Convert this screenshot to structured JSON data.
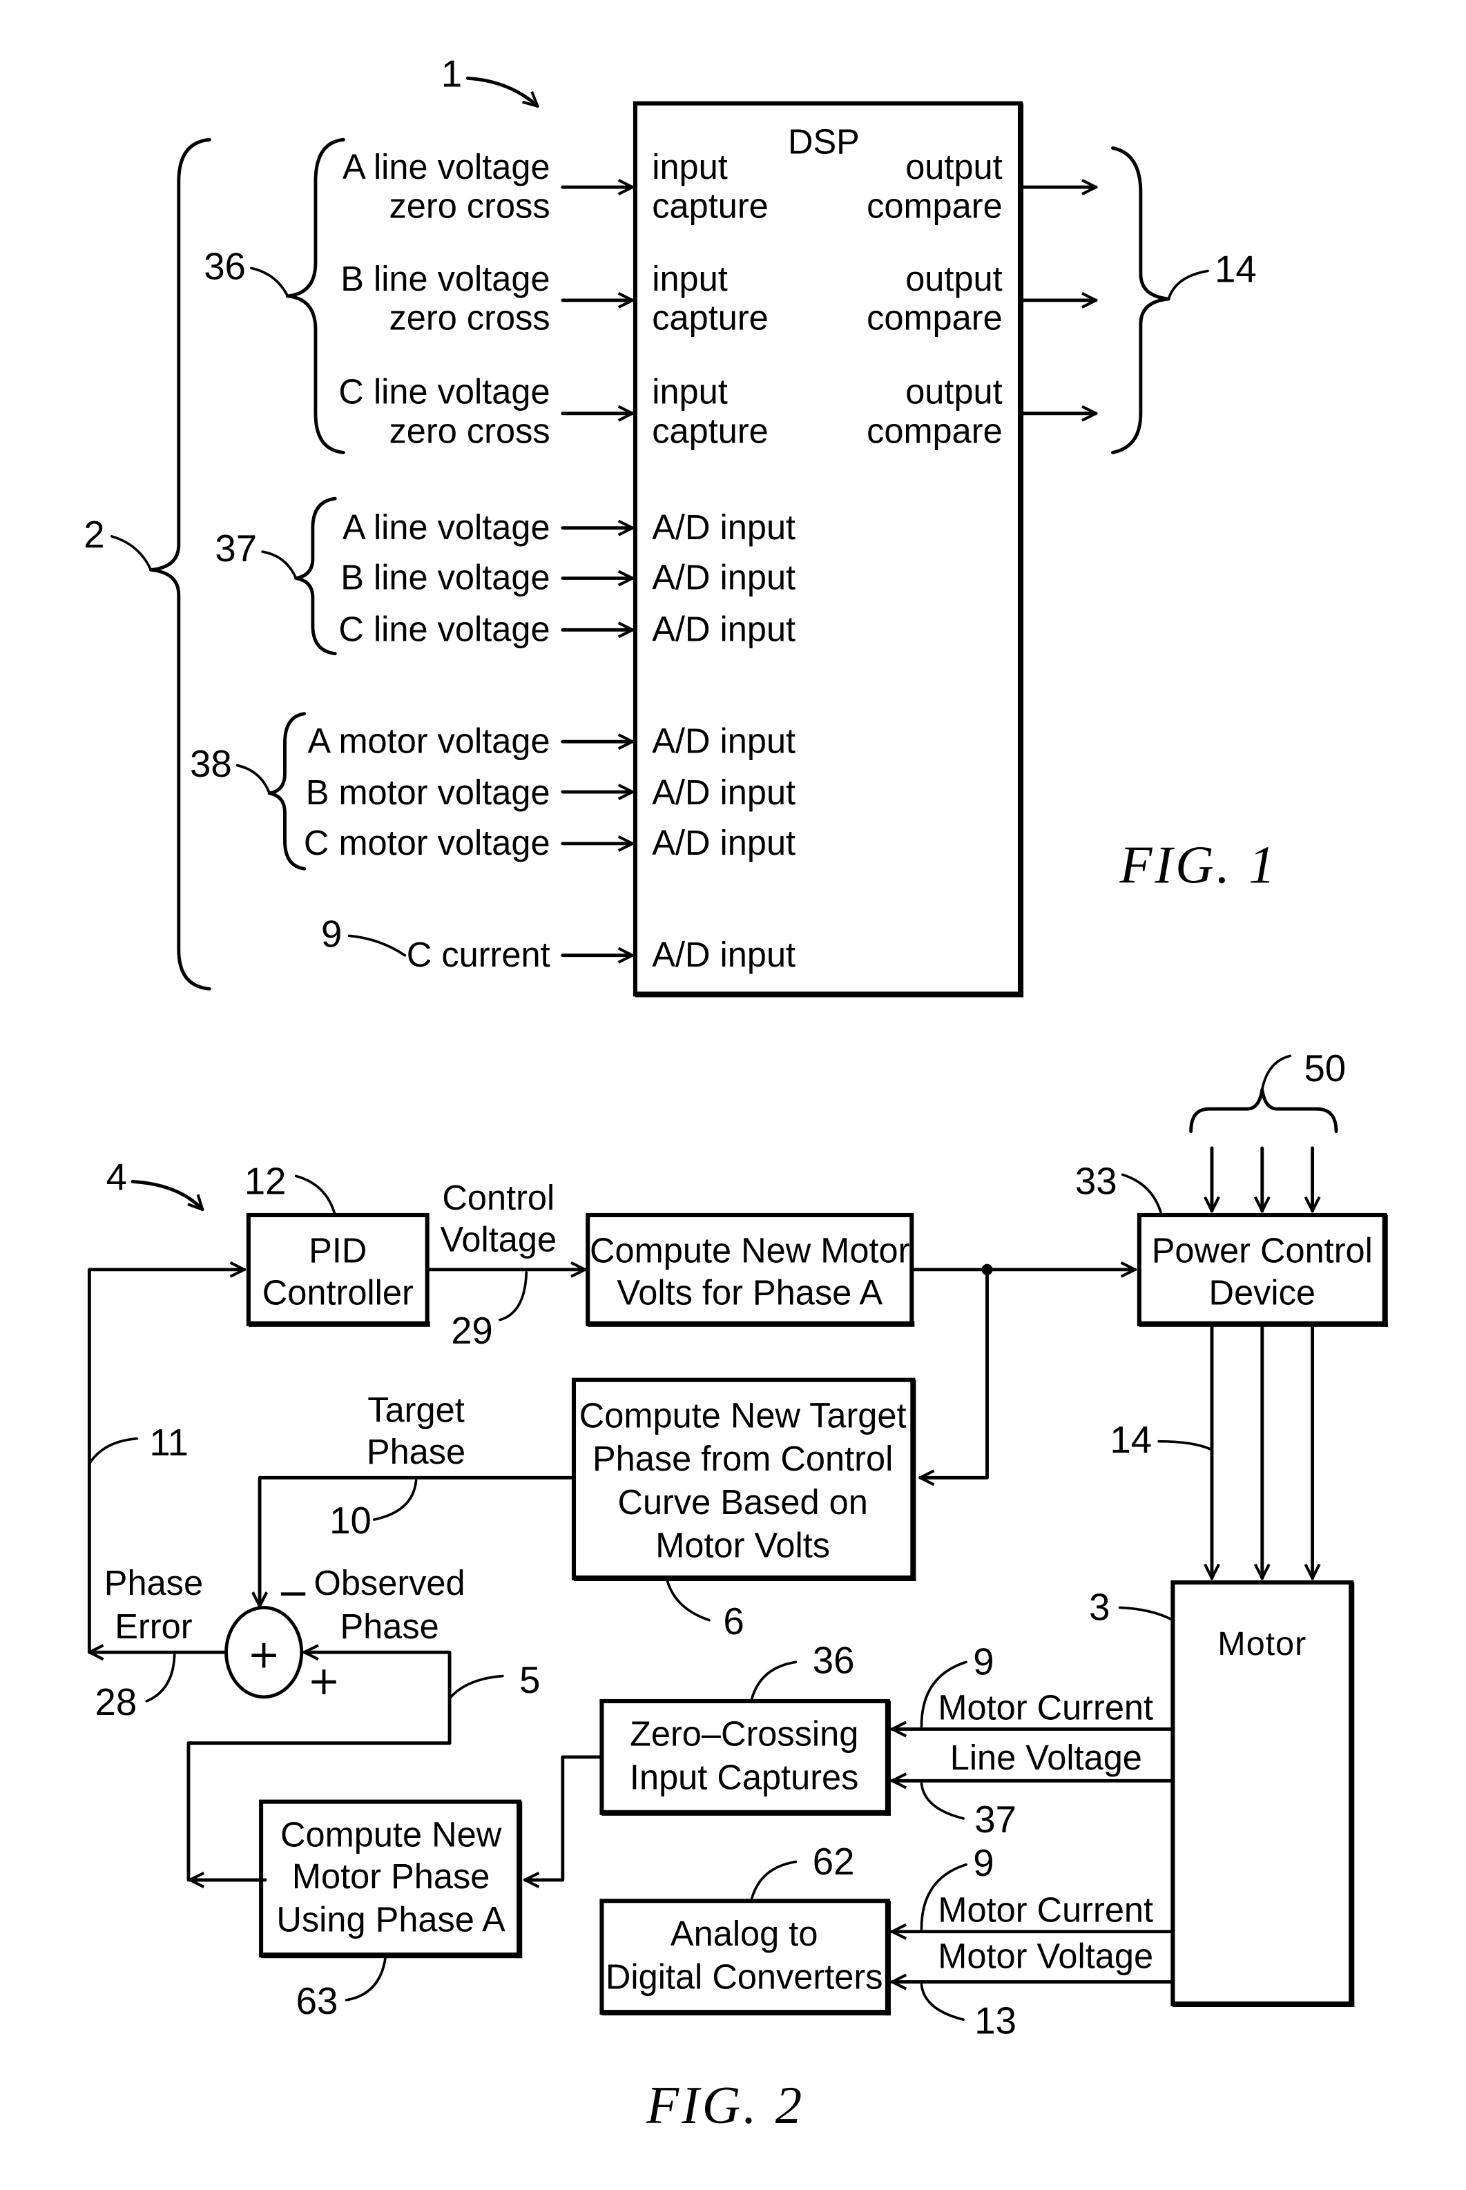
{
  "fig1": {
    "caption": "FIG.  1",
    "dsp_title": "DSP",
    "ref_system": "1",
    "ref_inputs": "2",
    "ref_zero_cross_group": "36",
    "ref_line_voltage_group": "37",
    "ref_motor_voltage_group": "38",
    "ref_current": "9",
    "ref_outputs": "14",
    "zero_cross_inputs": [
      {
        "line1": "A  line  voltage",
        "line2": "zero  cross",
        "port1": "input",
        "port2": "capture",
        "out1": "output",
        "out2": "compare"
      },
      {
        "line1": "B  line  voltage",
        "line2": "zero  cross",
        "port1": "input",
        "port2": "capture",
        "out1": "output",
        "out2": "compare"
      },
      {
        "line1": "C  line  voltage",
        "line2": "zero  cross",
        "port1": "input",
        "port2": "capture",
        "out1": "output",
        "out2": "compare"
      }
    ],
    "line_voltage_inputs": [
      {
        "label": "A  line  voltage",
        "port": "A/D  input"
      },
      {
        "label": "B  line  voltage",
        "port": "A/D  input"
      },
      {
        "label": "C  line  voltage",
        "port": "A/D  input"
      }
    ],
    "motor_voltage_inputs": [
      {
        "label": "A  motor  voltage",
        "port": "A/D  input"
      },
      {
        "label": "B  motor  voltage",
        "port": "A/D  input"
      },
      {
        "label": "C  motor  voltage",
        "port": "A/D  input"
      }
    ],
    "current_input": {
      "label": "C  current",
      "port": "A/D  input"
    }
  },
  "fig2": {
    "caption": "FIG.  2",
    "ref_system": "4",
    "blocks": {
      "pid": {
        "ref": "12",
        "lines": [
          "PID",
          "Controller"
        ]
      },
      "compute_volts": {
        "lines": [
          "Compute  New  Motor",
          "Volts  for  Phase  A"
        ]
      },
      "power_control": {
        "ref": "33",
        "lines": [
          "Power  Control",
          "Device"
        ]
      },
      "target_phase": {
        "ref": "6",
        "lines": [
          "Compute  New  Target",
          "Phase  from  Control",
          "Curve  Based  on",
          "Motor  Volts"
        ]
      },
      "motor": {
        "ref": "3",
        "lines": [
          "Motor"
        ]
      },
      "zero_crossing": {
        "ref": "36",
        "lines": [
          "Zero–Crossing",
          "Input  Captures"
        ]
      },
      "adc": {
        "ref": "62",
        "lines": [
          "Analog  to",
          "Digital  Converters"
        ]
      },
      "motor_phase": {
        "ref": "63",
        "lines": [
          "Compute  New",
          "Motor  Phase",
          "Using  Phase  A"
        ]
      }
    },
    "signals": {
      "control_voltage": {
        "ref": "29",
        "lines": [
          "Control",
          "Voltage"
        ]
      },
      "target_phase": {
        "ref": "10",
        "lines": [
          "Target",
          "Phase"
        ]
      },
      "observed_phase": {
        "ref": "5",
        "lines": [
          "Observed",
          "Phase"
        ]
      },
      "phase_error": {
        "ref": "28",
        "lines": [
          "Phase",
          "Error"
        ]
      },
      "feedback_ref": "11",
      "power_inputs_ref": "50",
      "motor_drive_ref": "14",
      "motor_current_1": {
        "ref": "9",
        "label": "Motor  Current"
      },
      "line_voltage": {
        "ref": "37",
        "label": "Line  Voltage"
      },
      "motor_current_2": {
        "ref": "9",
        "label": "Motor  Current"
      },
      "motor_voltage": {
        "ref": "13",
        "label": "Motor  Voltage"
      }
    },
    "summer": {
      "minus": "−",
      "plus": "+",
      "symbol": "+"
    }
  }
}
